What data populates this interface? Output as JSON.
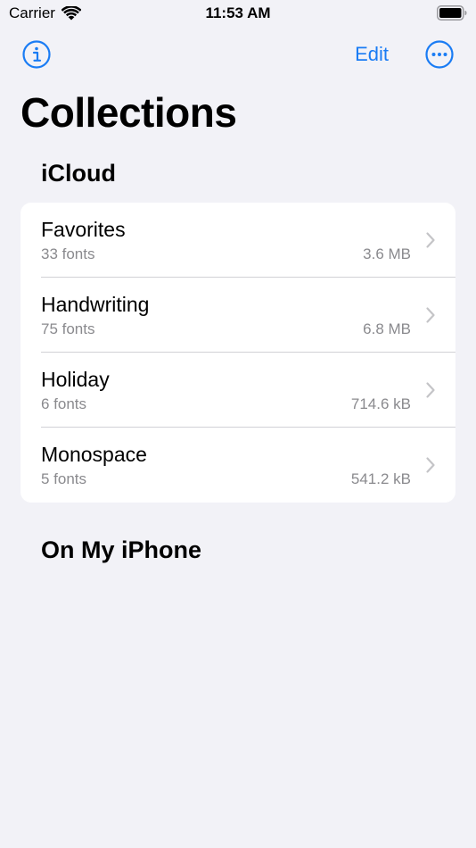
{
  "status_bar": {
    "carrier": "Carrier",
    "time": "11:53 AM"
  },
  "nav": {
    "edit_label": "Edit",
    "info_icon": "info-circle-icon",
    "more_icon": "ellipsis-circle-icon"
  },
  "title": "Collections",
  "sections": {
    "icloud": "iCloud",
    "iphone": "On My iPhone"
  },
  "collections": [
    {
      "name": "Favorites",
      "count": "33 fonts",
      "size": "3.6 MB"
    },
    {
      "name": "Handwriting",
      "count": "75 fonts",
      "size": "6.8 MB"
    },
    {
      "name": "Holiday",
      "count": "6 fonts",
      "size": "714.6 kB"
    },
    {
      "name": "Monospace",
      "count": "5 fonts",
      "size": "541.2 kB"
    }
  ],
  "colors": {
    "accent": "#1a7cf4",
    "background": "#f2f2f7",
    "secondary_text": "#8a8a8e",
    "separator": "#d1d1d6"
  }
}
